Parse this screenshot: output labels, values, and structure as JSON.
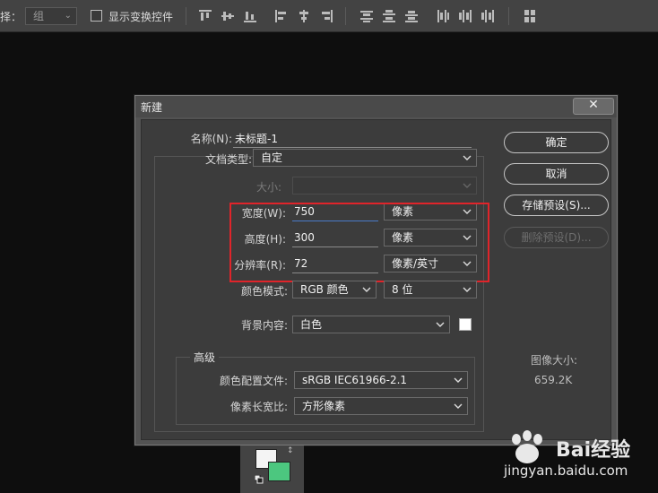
{
  "topbar": {
    "select_label": "择：",
    "select_value": "组",
    "show_transform_label": "显示变换控件"
  },
  "dialog": {
    "title": "新建",
    "name_label": "名称(N):",
    "name_value": "未标题-1",
    "doc_type_label": "文档类型:",
    "doc_type_value": "自定",
    "size_label": "大小:",
    "width_label": "宽度(W):",
    "width_value": "750",
    "width_unit": "像素",
    "height_label": "高度(H):",
    "height_value": "300",
    "height_unit": "像素",
    "resolution_label": "分辨率(R):",
    "resolution_value": "72",
    "resolution_unit": "像素/英寸",
    "color_mode_label": "颜色模式:",
    "color_mode_value": "RGB 颜色",
    "bit_depth_value": "8 位",
    "background_label": "背景内容:",
    "background_value": "白色",
    "advanced_label": "高级",
    "color_profile_label": "颜色配置文件:",
    "color_profile_value": "sRGB IEC61966-2.1",
    "pixel_aspect_label": "像素长宽比:",
    "pixel_aspect_value": "方形像素",
    "ok_label": "确定",
    "cancel_label": "取消",
    "save_preset_label": "存储预设(S)...",
    "delete_preset_label": "删除预设(D)...",
    "image_size_label": "图像大小:",
    "image_size_value": "659.2K",
    "close_glyph": "✕"
  },
  "watermark": {
    "brand": "Bai",
    "brand_cn": "经验",
    "url": "jingyan.baidu.com"
  },
  "colors": {
    "foreground": "#f4f4f4",
    "background": "#4cc77f",
    "highlight_border": "#e0242a"
  }
}
